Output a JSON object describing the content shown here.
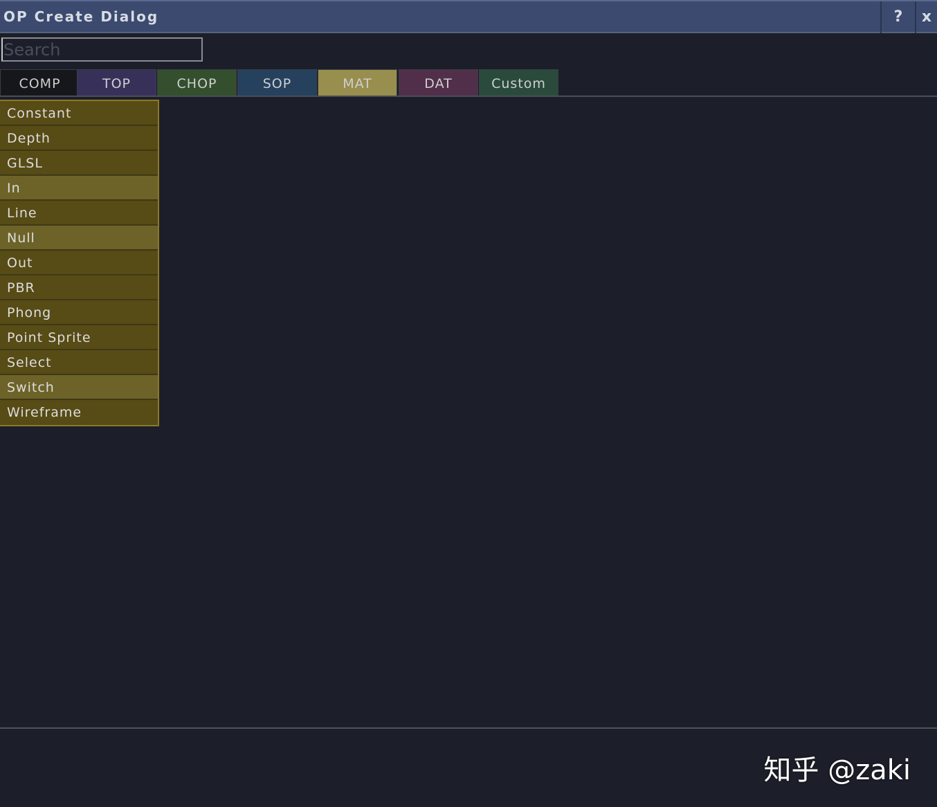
{
  "window": {
    "title": "OP Create Dialog",
    "help_label": "?",
    "close_label": "x"
  },
  "search": {
    "placeholder": "Search",
    "value": ""
  },
  "tabs": [
    {
      "label": "COMP",
      "color": "#16171b"
    },
    {
      "label": "TOP",
      "color": "#37315a"
    },
    {
      "label": "CHOP",
      "color": "#334f2d"
    },
    {
      "label": "SOP",
      "color": "#25415e"
    },
    {
      "label": "MAT",
      "color": "#988e4e",
      "selected": true
    },
    {
      "label": "DAT",
      "color": "#512f4a"
    },
    {
      "label": "Custom",
      "color": "#2a4b3b"
    }
  ],
  "operators": [
    {
      "label": "Constant"
    },
    {
      "label": "Depth"
    },
    {
      "label": "GLSL"
    },
    {
      "label": "In",
      "highlight": true
    },
    {
      "label": "Line"
    },
    {
      "label": "Null",
      "highlight": true
    },
    {
      "label": "Out"
    },
    {
      "label": "PBR"
    },
    {
      "label": "Phong"
    },
    {
      "label": "Point Sprite"
    },
    {
      "label": "Select"
    },
    {
      "label": "Switch",
      "highlight": true
    },
    {
      "label": "Wireframe"
    }
  ],
  "watermark": "知乎 @zaki"
}
